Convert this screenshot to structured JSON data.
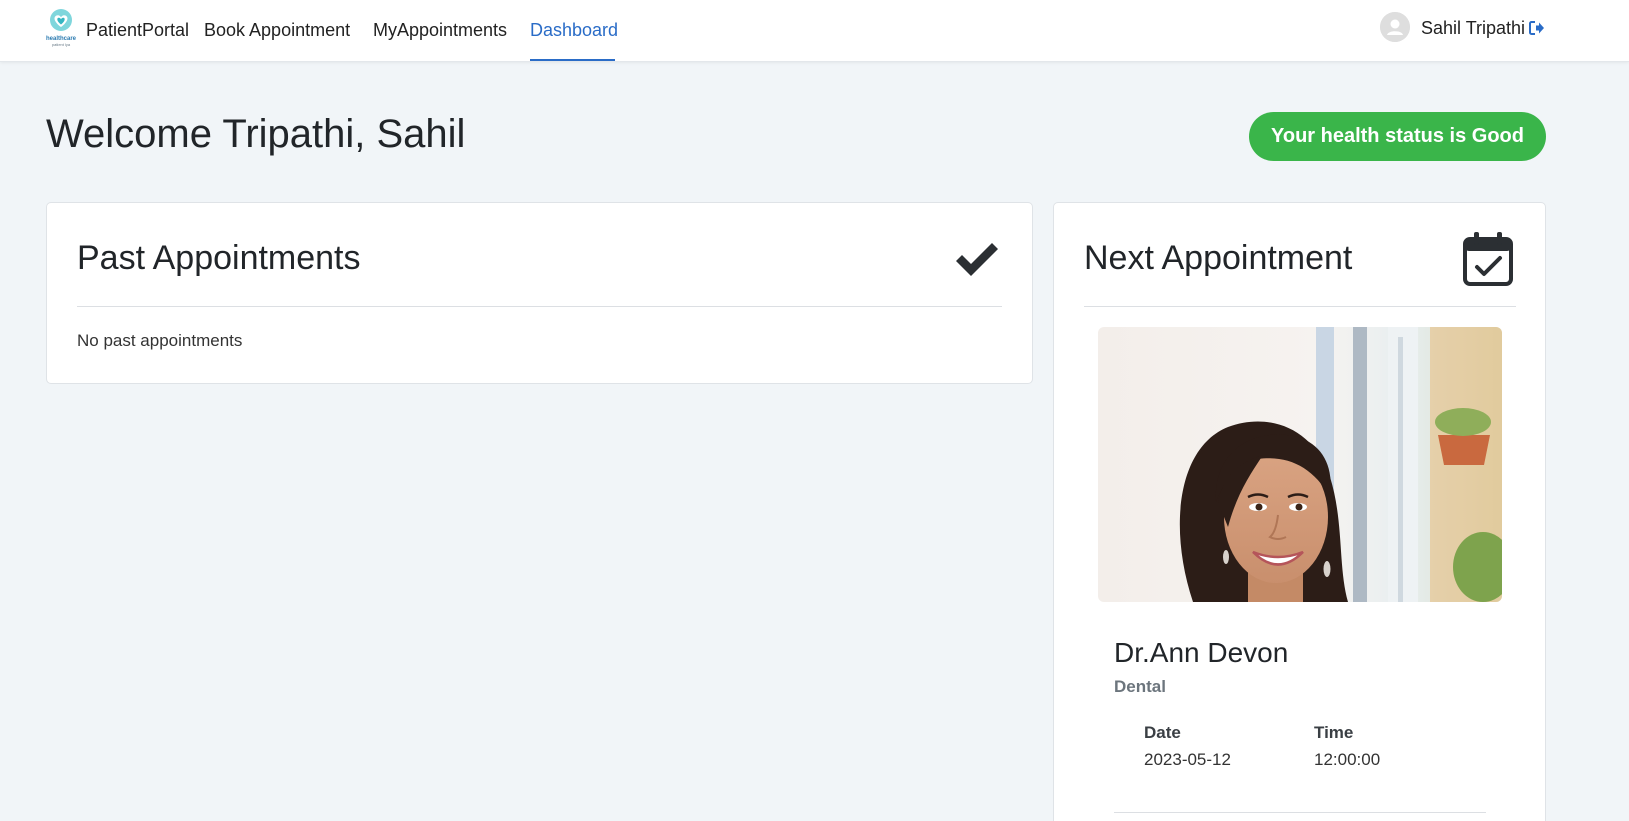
{
  "brand": {
    "logo_text": "healthcare",
    "logo_subtext": "patient lya",
    "name": "PatientPortal"
  },
  "nav": {
    "links": [
      {
        "label": "Book Appointment"
      },
      {
        "label": "MyAppointments"
      },
      {
        "label": "Dashboard",
        "active": true
      }
    ]
  },
  "user": {
    "name": "Sahil Tripathi"
  },
  "welcome": {
    "title": "Welcome Tripathi, Sahil"
  },
  "health_status": {
    "label": "Your health status is Good",
    "color": "#3ab54a"
  },
  "past_appointments": {
    "title": "Past Appointments",
    "icon": "check-icon",
    "empty_text": "No past appointments"
  },
  "next_appointment": {
    "title": "Next Appointment",
    "icon": "calendar-check-icon",
    "doctor_name": "Dr.Ann Devon",
    "specialty": "Dental",
    "date_label": "Date",
    "date_value": "2023-05-12",
    "time_label": "Time",
    "time_value": "12:00:00"
  },
  "colors": {
    "accent": "#2a6cc7",
    "background": "#f1f5f8"
  }
}
